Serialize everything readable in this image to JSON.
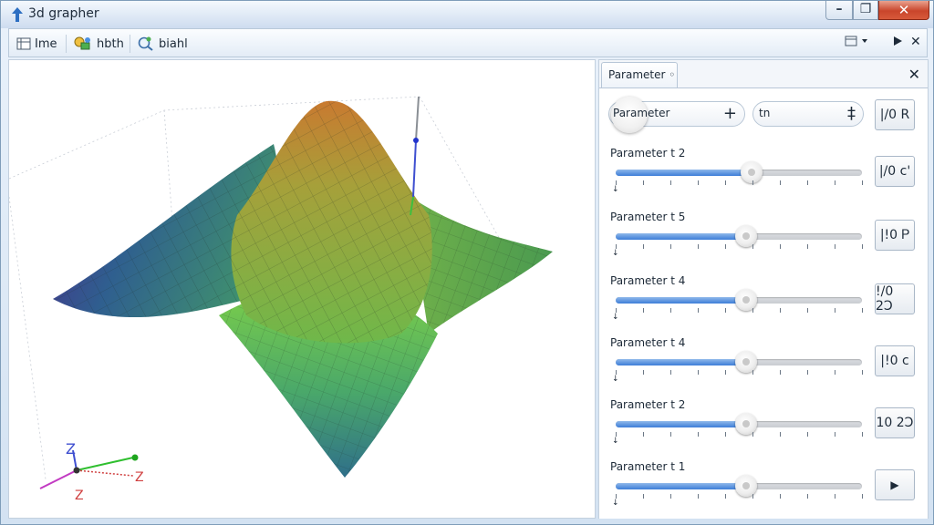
{
  "window": {
    "title": "3d grapher"
  },
  "toolbar": {
    "items": [
      {
        "label": "Ime"
      },
      {
        "label": "hbth"
      },
      {
        "label": "biahl"
      }
    ]
  },
  "panel": {
    "tab_label": "Parameter ◦",
    "field1": {
      "value": "Parameter"
    },
    "field2": {
      "value": "tn"
    },
    "buttons": [
      "|/0 R",
      "|/0 c'",
      "|!0 Ꮲ",
      "!/0 2Ↄ",
      "|!0 c",
      "10 2Ↄ",
      "▶"
    ],
    "sliders": [
      {
        "label": "Parameter t 2",
        "value": 0.55
      },
      {
        "label": "Parameter t 5",
        "value": 0.53
      },
      {
        "label": "Parameter t 4",
        "value": 0.53
      },
      {
        "label": "Parameter t 4",
        "value": 0.53
      },
      {
        "label": "Parameter t 2",
        "value": 0.53
      },
      {
        "label": "Parameter t 1",
        "value": 0.53
      }
    ]
  },
  "axes": {
    "z": "Z",
    "x": "Z",
    "y": "Z"
  }
}
